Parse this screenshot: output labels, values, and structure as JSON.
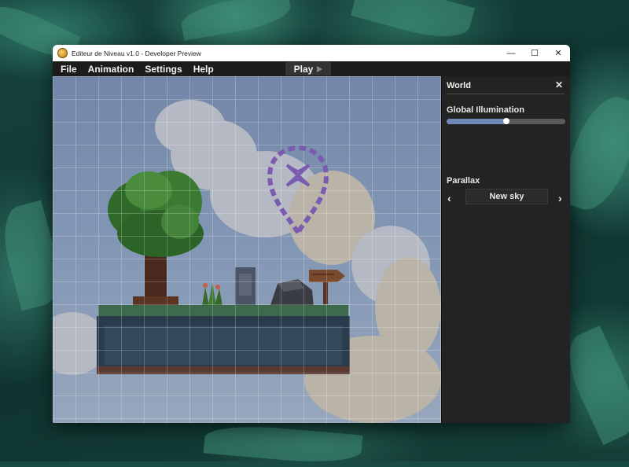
{
  "window": {
    "title": "Editeur de Niveau v1.0 - Developer Preview",
    "controls": {
      "minimize": "—",
      "maximize": "☐",
      "close": "✕"
    }
  },
  "menu": {
    "items": [
      "File",
      "Animation",
      "Settings",
      "Help"
    ],
    "play_label": "Play"
  },
  "panel": {
    "title": "World",
    "close_glyph": "✕",
    "global_illumination": {
      "label": "Global Illumination",
      "value": 0.5
    },
    "parallax": {
      "label": "Parallax",
      "selected": "New sky",
      "prev_glyph": "‹",
      "next_glyph": "›"
    }
  },
  "colors": {
    "accent": "#6f88b3",
    "marker": "#7b5bb0",
    "panel_bg": "#232323",
    "menubar_bg": "#1c1c1c"
  },
  "icons": [
    "app-icon",
    "play-icon",
    "map-marker-icon",
    "close-icon",
    "chevron-left-icon",
    "chevron-right-icon"
  ]
}
